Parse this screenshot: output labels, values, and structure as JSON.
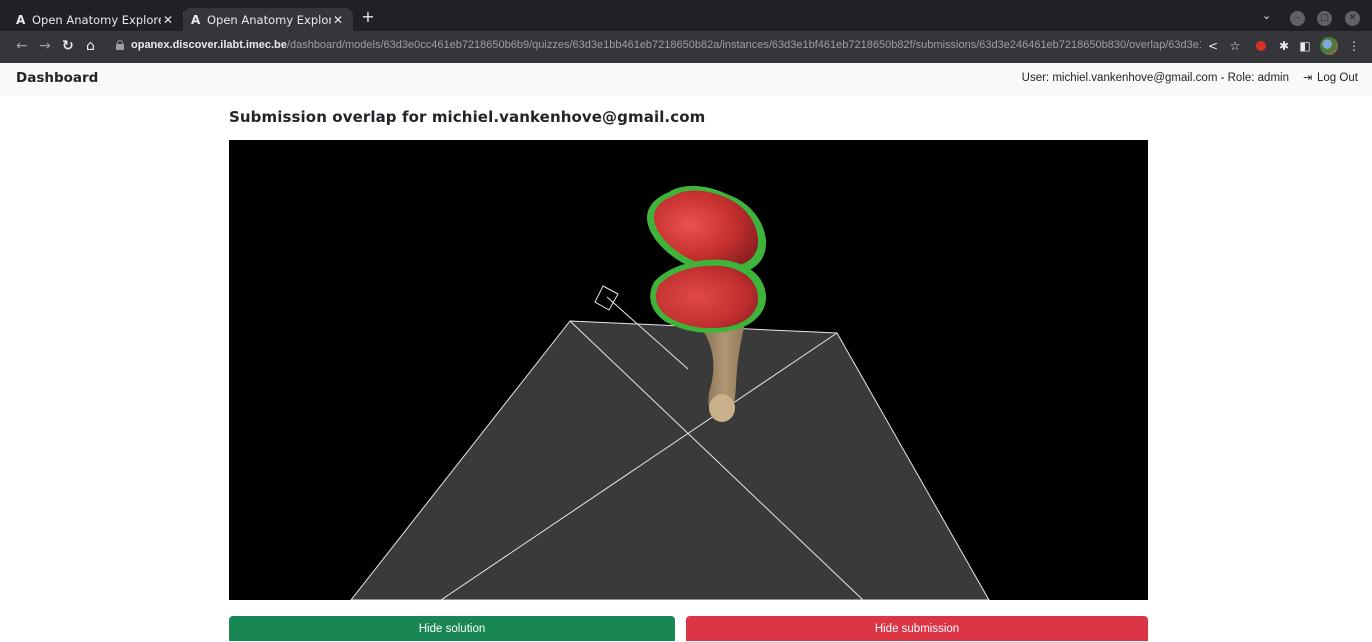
{
  "browser": {
    "tabs": [
      {
        "favicon": "A",
        "title": "Open Anatomy Explorer",
        "active": false
      },
      {
        "favicon": "A",
        "title": "Open Anatomy Explorer",
        "active": true
      }
    ],
    "new_tab": "+",
    "tab_search": "⌄",
    "window_controls": {
      "minimize": "–",
      "maximize": "▢",
      "close": "✕"
    },
    "nav": {
      "back": "←",
      "forward": "→",
      "reload": "↻",
      "home": "⌂"
    },
    "address": {
      "host": "opanex.discover.ilabt.imec.be",
      "path": "/dashboard/models/63d3e0cc461eb7218650b6b9/quizzes/63d3e1bb461eb7218650b82a/instances/63d3e1bf461eb7218650b82f/submissions/63d3e246461eb7218650b830/overlap/63d3e1bb461eb72186…"
    },
    "toolbar_icons": {
      "share": "<",
      "bookmark": "☆",
      "puzzle": "✱",
      "sidepanel": "◧",
      "menu": "⋮"
    }
  },
  "navbar": {
    "brand": "Dashboard",
    "user_info": "User: michiel.vankenhove@gmail.com - Role: admin",
    "logout_icon": "⇥",
    "logout_label": "Log Out"
  },
  "page": {
    "title": "Submission overlap for michiel.vankenhove@gmail.com"
  },
  "buttons": {
    "hide_solution": "Hide solution",
    "hide_submission": "Hide submission"
  },
  "colors": {
    "solution": "#198754",
    "submission": "#dc3545",
    "overlay_green": "#3fb43a",
    "overlay_red": "#c8383a",
    "bone": "#a88f6a",
    "viewer_bg": "#000000",
    "floor": "#3a3a3a"
  }
}
